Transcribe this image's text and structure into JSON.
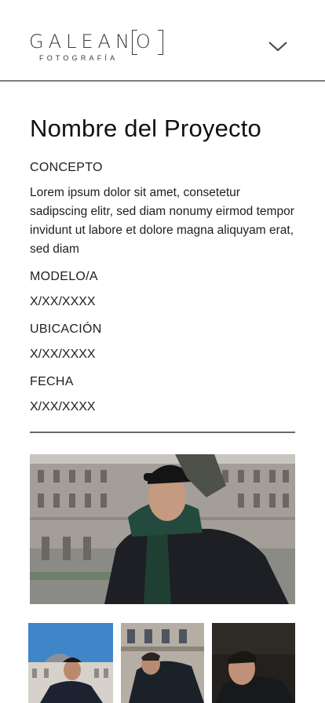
{
  "header": {
    "logo_wordmark": "GALEAN",
    "logo_o": "O",
    "logo_subtitle": "FOTOGRAFÍA"
  },
  "project": {
    "title": "Nombre del Proyecto",
    "concept_label": "CONCEPTO",
    "concept_text": "Lorem ipsum dolor sit amet, consetetur sadipscing elitr, sed diam nonumy eirmod tempor invidunt ut labore et dolore magna aliquyam erat, sed diam",
    "model_label": "MODELO/A",
    "model_value": "X/XX/XXXX",
    "location_label": "UBICACIÓN",
    "location_value": "X/XX/XXXX",
    "date_label": "FECHA",
    "date_value": "X/XX/XXXX"
  },
  "icons": {
    "menu": "chevron-down-icon"
  },
  "colors": {
    "text": "#1b1b1b",
    "divider": "#6a6a6a",
    "sky": "#3f86c9"
  }
}
